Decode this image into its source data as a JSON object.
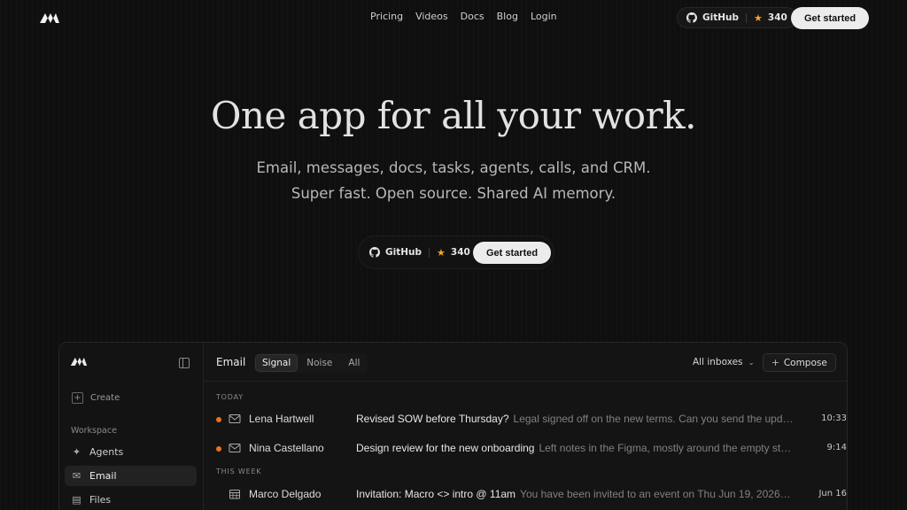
{
  "nav": {
    "links": [
      "Pricing",
      "Videos",
      "Docs",
      "Blog",
      "Login"
    ],
    "github_label": "GitHub",
    "github_stars": "340",
    "cta_label": "Get started"
  },
  "hero": {
    "title": "One app for all your work.",
    "subtitle_line1": "Email, messages, docs, tasks, agents, calls, and CRM.",
    "subtitle_line2": "Super fast. Open source. Shared AI memory.",
    "github_label": "GitHub",
    "github_stars": "340",
    "cta_label": "Get started"
  },
  "app": {
    "sidebar": {
      "create_label": "Create",
      "section_label": "Workspace",
      "items": [
        {
          "label": "Agents",
          "icon": "sparkle-icon"
        },
        {
          "label": "Email",
          "icon": "mail-icon"
        },
        {
          "label": "Files",
          "icon": "files-icon"
        }
      ]
    },
    "header": {
      "title": "Email",
      "tabs": [
        "Signal",
        "Noise",
        "All"
      ],
      "inboxes_label": "All inboxes",
      "compose_label": "Compose"
    },
    "sections": {
      "today": "TODAY",
      "this_week": "THIS WEEK"
    },
    "emails": [
      {
        "sender": "Lena Hartwell",
        "subject": "Revised SOW before Thursday?",
        "preview": "Legal signed off on the new terms. Can you send the upd…",
        "time": "10:33",
        "unread": true,
        "icon": "mail-icon"
      },
      {
        "sender": "Nina Castellano",
        "subject": "Design review for the new onboarding",
        "preview": "Left notes in the Figma, mostly around the empty st…",
        "time": "9:14",
        "unread": true,
        "icon": "mail-icon"
      },
      {
        "sender": "Marco Delgado",
        "subject": "Invitation: Macro <> intro @ 11am",
        "preview": "You have been invited to an event on Thu Jun 19, 2026…",
        "time": "Jun 16",
        "unread": false,
        "icon": "calendar-icon"
      }
    ]
  },
  "colors": {
    "background": "#0f0f0f",
    "accent_star": "#f5a623",
    "unread_dot": "#e8731f",
    "button_bg": "#ececec"
  }
}
